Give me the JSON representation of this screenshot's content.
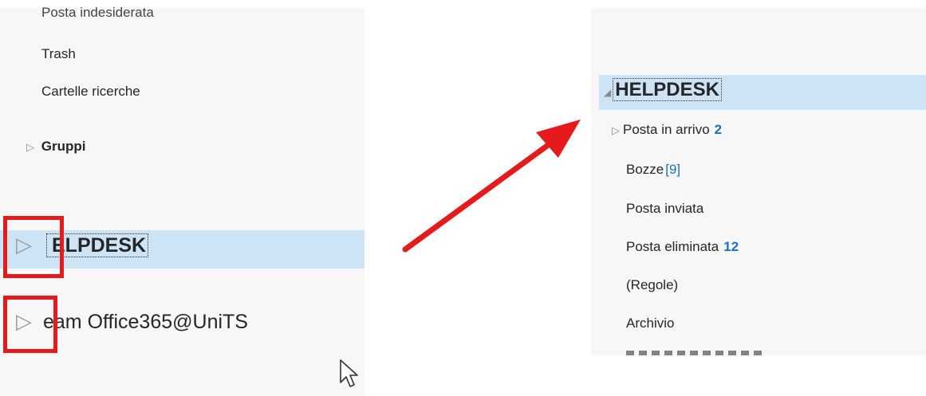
{
  "left": {
    "items": [
      {
        "label": "Posta indesiderata"
      },
      {
        "label": "Trash"
      },
      {
        "label": "Cartelle ricerche"
      }
    ],
    "groups_label": "Gruppi",
    "helpdesk_label": "ELPDESK",
    "team_label": "eam Office365@UniTS"
  },
  "right": {
    "account_label": "HELPDESK",
    "folders": [
      {
        "label": "Posta in arrivo",
        "count": "2"
      },
      {
        "label": "Bozze",
        "count": "[9]"
      },
      {
        "label": "Posta inviata",
        "count": ""
      },
      {
        "label": "Posta eliminata",
        "count": "12"
      },
      {
        "label": "(Regole)",
        "count": ""
      },
      {
        "label": "Archivio",
        "count": ""
      }
    ]
  },
  "colors": {
    "highlight": "#cde4f7",
    "annotation_red": "#e51b1b",
    "count_blue": "#1f6fbf"
  },
  "icons": {
    "expand_caret": "triangle-right",
    "collapse_caret": "triangle-down-left",
    "cursor": "mouse-pointer"
  }
}
